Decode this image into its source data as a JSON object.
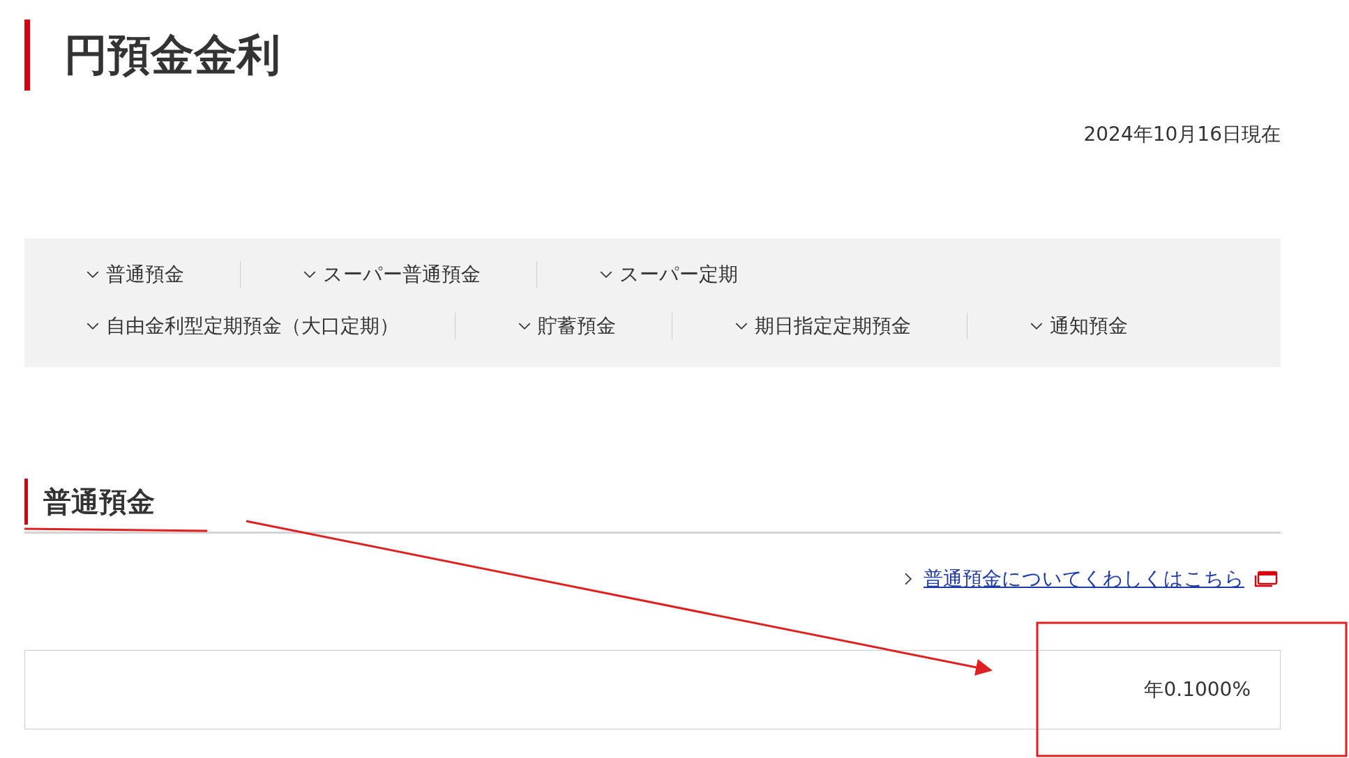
{
  "title": "円預金金利",
  "as_of": "2024年10月16日現在",
  "nav_rows": [
    [
      "普通預金",
      "スーパー普通預金",
      "スーパー定期"
    ],
    [
      "自由金利型定期預金（大口定期）",
      "貯蓄預金",
      "期日指定定期預金",
      "通知預金"
    ]
  ],
  "section": {
    "heading": "普通預金",
    "link": "普通預金についてくわしくはこちら",
    "rate": "年0.1000%"
  }
}
